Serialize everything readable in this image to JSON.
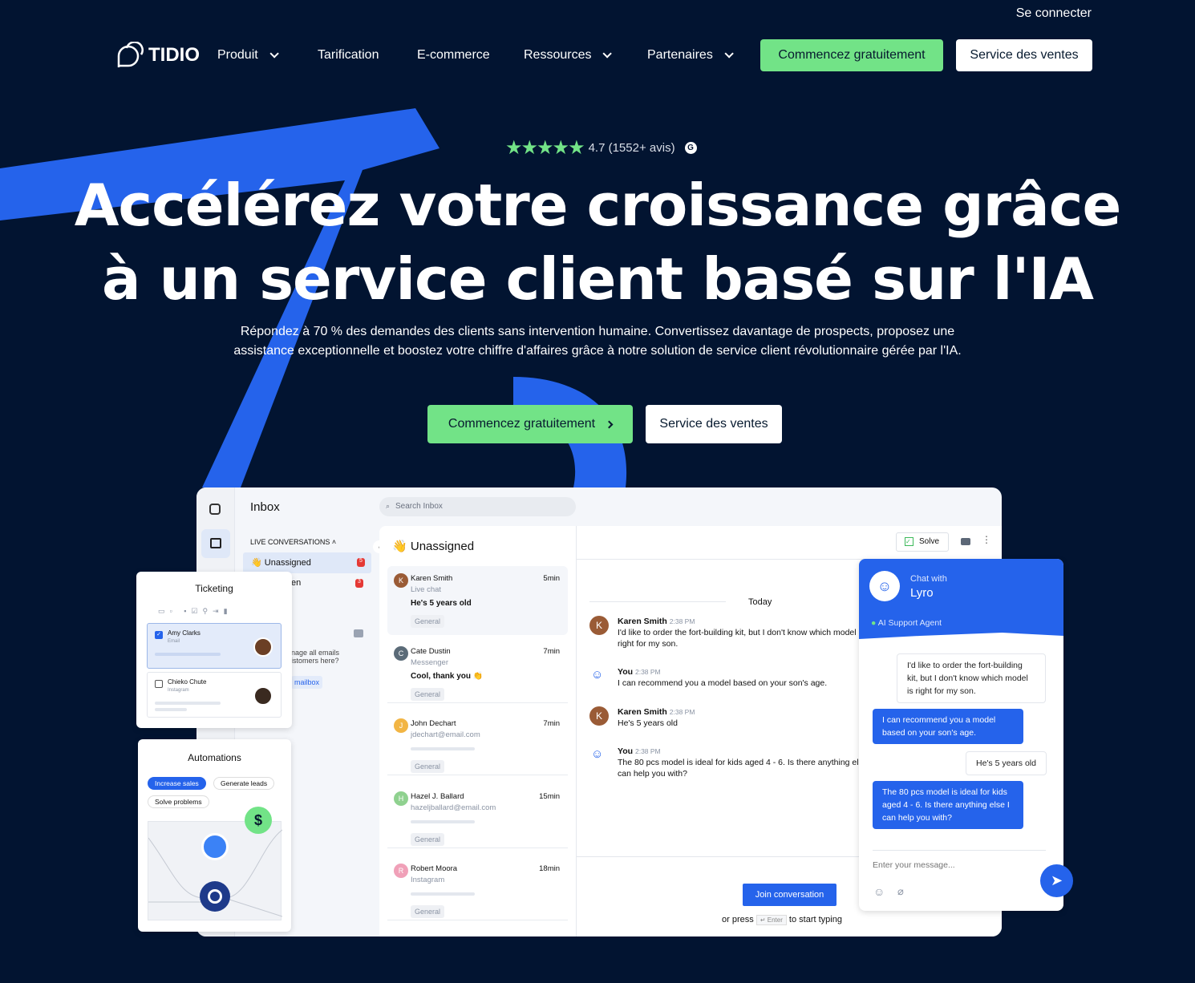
{
  "colors": {
    "background": "#021431",
    "accent_blue": "#2563eb",
    "accent_green": "#72e387"
  },
  "topbar": {
    "login": "Se connecter"
  },
  "nav": {
    "logo": "TIDIO",
    "items": [
      {
        "label": "Produit",
        "dropdown": true
      },
      {
        "label": "Tarification"
      },
      {
        "label": "E-commerce"
      },
      {
        "label": "Ressources",
        "dropdown": true
      },
      {
        "label": "Partenaires",
        "dropdown": true
      }
    ],
    "cta_primary": "Commencez gratuitement",
    "cta_secondary": "Service des ventes"
  },
  "hero": {
    "rating": {
      "stars": 5,
      "value": "4.7 (1552+ avis)",
      "icon": "g2-icon"
    },
    "title_line1": "Accélérez votre croissance grâce",
    "title_line2": "à un service client basé sur l'IA",
    "subtitle": "Répondez à 70 % des demandes des clients sans intervention humaine. Convertissez davantage de prospects, proposez une assistance exceptionnelle et boostez votre chiffre d'affaires grâce à notre solution de service client révolutionnaire gérée par l'IA.",
    "cta_primary": "Commencez gratuitement",
    "cta_secondary": "Service des ventes"
  },
  "app": {
    "title": "Inbox",
    "search_placeholder": "Search Inbox",
    "section": "LIVE CONVERSATIONS",
    "folders": [
      {
        "label": "Unassigned",
        "count": "5"
      },
      {
        "label": "en",
        "count": "3"
      }
    ],
    "empty_text_1": "nage all emails",
    "empty_text_2": "istomers here?",
    "mailbox_btn": "mailbox",
    "list_title": "Unassigned",
    "conversations": [
      {
        "initial": "K",
        "name": "Karen Smith",
        "channel": "Live chat",
        "time": "5min",
        "message": "He's 5 years old",
        "tag": "General",
        "color": "#9a5b36"
      },
      {
        "initial": "C",
        "name": "Cate Dustin",
        "channel": "Messenger",
        "time": "7min",
        "message": "Cool, thank you 👏",
        "tag": "General",
        "color": "#5b6b78"
      },
      {
        "initial": "J",
        "name": "John Dechart",
        "channel": "jdechart@email.com",
        "time": "7min",
        "message": "",
        "tag": "General",
        "color": "#f2b544"
      },
      {
        "initial": "H",
        "name": "Hazel J. Ballard",
        "channel": "hazeljballard@email.com",
        "time": "15min",
        "message": "",
        "tag": "General",
        "color": "#8fd18f"
      },
      {
        "initial": "R",
        "name": "Robert Moora",
        "channel": "Instagram",
        "time": "18min",
        "message": "",
        "tag": "General",
        "color": "#f0a0b8"
      }
    ],
    "solve": "Solve",
    "day": "Today",
    "messages": [
      {
        "author": "Karen Smith",
        "time": "2:38 PM",
        "text": "I'd like to order the fort-building kit, but I don't know which model is right for my son.",
        "bot": false
      },
      {
        "author": "You",
        "time": "2:38 PM",
        "text": "I can recommend you a model based on your son's age.",
        "bot": true
      },
      {
        "author": "Karen Smith",
        "time": "2:38 PM",
        "text": "He's 5 years old",
        "bot": false
      },
      {
        "author": "You",
        "time": "2:38 PM",
        "text": "The 80 pcs model is ideal for kids aged 4 - 6. Is there anything else I can help you with?",
        "bot": true
      }
    ],
    "join": "Join conversation",
    "or_press": "or press",
    "enter_key": "↵ Enter",
    "to_type": "to start typing"
  },
  "ticketing": {
    "title": "Ticketing",
    "items": [
      {
        "name": "Amy Clarks",
        "channel": "Email",
        "checked": true
      },
      {
        "name": "Chieko Chute",
        "channel": "Instagram",
        "checked": false
      }
    ]
  },
  "automations": {
    "title": "Automations",
    "chips": [
      "Increase sales",
      "Generate leads",
      "Solve problems"
    ],
    "active_chip": "Increase sales"
  },
  "lyro": {
    "chat_with": "Chat with",
    "name": "Lyro",
    "status": "AI Support Agent",
    "messages": [
      {
        "from": "user",
        "text": "I'd like to order the fort-building kit, but I don't know which model is right for my son."
      },
      {
        "from": "bot",
        "text": "I can recommend you a model based on your son's age."
      },
      {
        "from": "user",
        "text": "He's 5 years old"
      },
      {
        "from": "bot",
        "text": "The 80 pcs model is ideal for kids aged 4 - 6. Is there anything else I can help you with?"
      }
    ],
    "input_placeholder": "Enter your message..."
  }
}
